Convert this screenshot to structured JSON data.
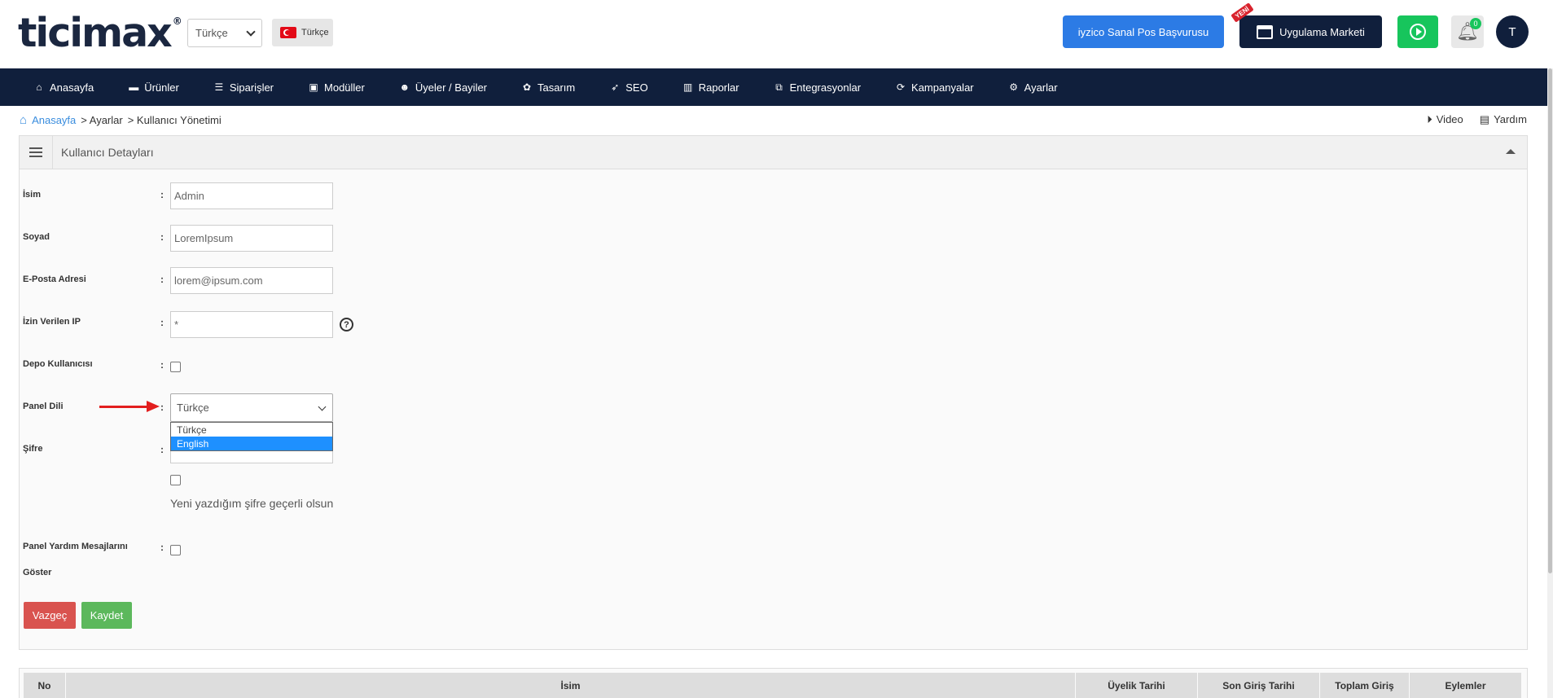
{
  "header": {
    "logo_text": "ticimax",
    "logo_mark": "®",
    "language_select": "Türkçe",
    "language_flag_label": "Türkçe",
    "iyzico_button": "iyzico Sanal Pos Başvurusu",
    "market_button": "Uygulama Marketi",
    "new_badge": "YENİ",
    "notification_count": "0",
    "avatar_initial": "T"
  },
  "nav": {
    "items": [
      {
        "label": "Anasayfa",
        "icon": "⌂"
      },
      {
        "label": "Ürünler",
        "icon": "▬"
      },
      {
        "label": "Siparişler",
        "icon": "☰"
      },
      {
        "label": "Modüller",
        "icon": "▣"
      },
      {
        "label": "Üyeler / Bayiler",
        "icon": "☻"
      },
      {
        "label": "Tasarım",
        "icon": "✿"
      },
      {
        "label": "SEO",
        "icon": "➶"
      },
      {
        "label": "Raporlar",
        "icon": "▥"
      },
      {
        "label": "Entegrasyonlar",
        "icon": "⧉"
      },
      {
        "label": "Kampanyalar",
        "icon": "⟳"
      },
      {
        "label": "Ayarlar",
        "icon": "⚙"
      }
    ]
  },
  "breadcrumb": {
    "home": "Anasayfa",
    "level1": "> Ayarlar",
    "level2": "> Kullanıcı Yönetimi",
    "video": "Video",
    "help": "Yardım"
  },
  "panel": {
    "title": "Kullanıcı Detayları"
  },
  "form": {
    "name_label": "İsim",
    "name_value": "Admin",
    "surname_label": "Soyad",
    "surname_value": "LoremIpsum",
    "email_label": "E-Posta Adresi",
    "email_value": "lorem@ipsum.com",
    "ip_label": "İzin Verilen IP",
    "ip_value": "*",
    "warehouse_label": "Depo Kullanıcısı",
    "panel_lang_label": "Panel Dili",
    "panel_lang_value": "Türkçe",
    "panel_lang_options": [
      "Türkçe",
      "English"
    ],
    "password_label": "Şifre",
    "password_hint": "Yeni yazdığım şifre geçerli olsun",
    "help_msg_label_1": "Panel Yardım Mesajlarını",
    "help_msg_label_2": "Göster",
    "colon": ":",
    "help_glyph": "?",
    "cancel_button": "Vazgeç",
    "save_button": "Kaydet"
  },
  "table": {
    "headers": [
      "No",
      "İsim",
      "Üyelik Tarihi",
      "Son Giriş Tarihi",
      "Toplam Giriş",
      "Eylemler"
    ]
  },
  "colors": {
    "navy": "#101f3c",
    "accent_blue": "#2c7be5",
    "green": "#17c55c",
    "danger": "#d9534f",
    "success": "#5cb85c",
    "arrow": "#e21e1e"
  }
}
